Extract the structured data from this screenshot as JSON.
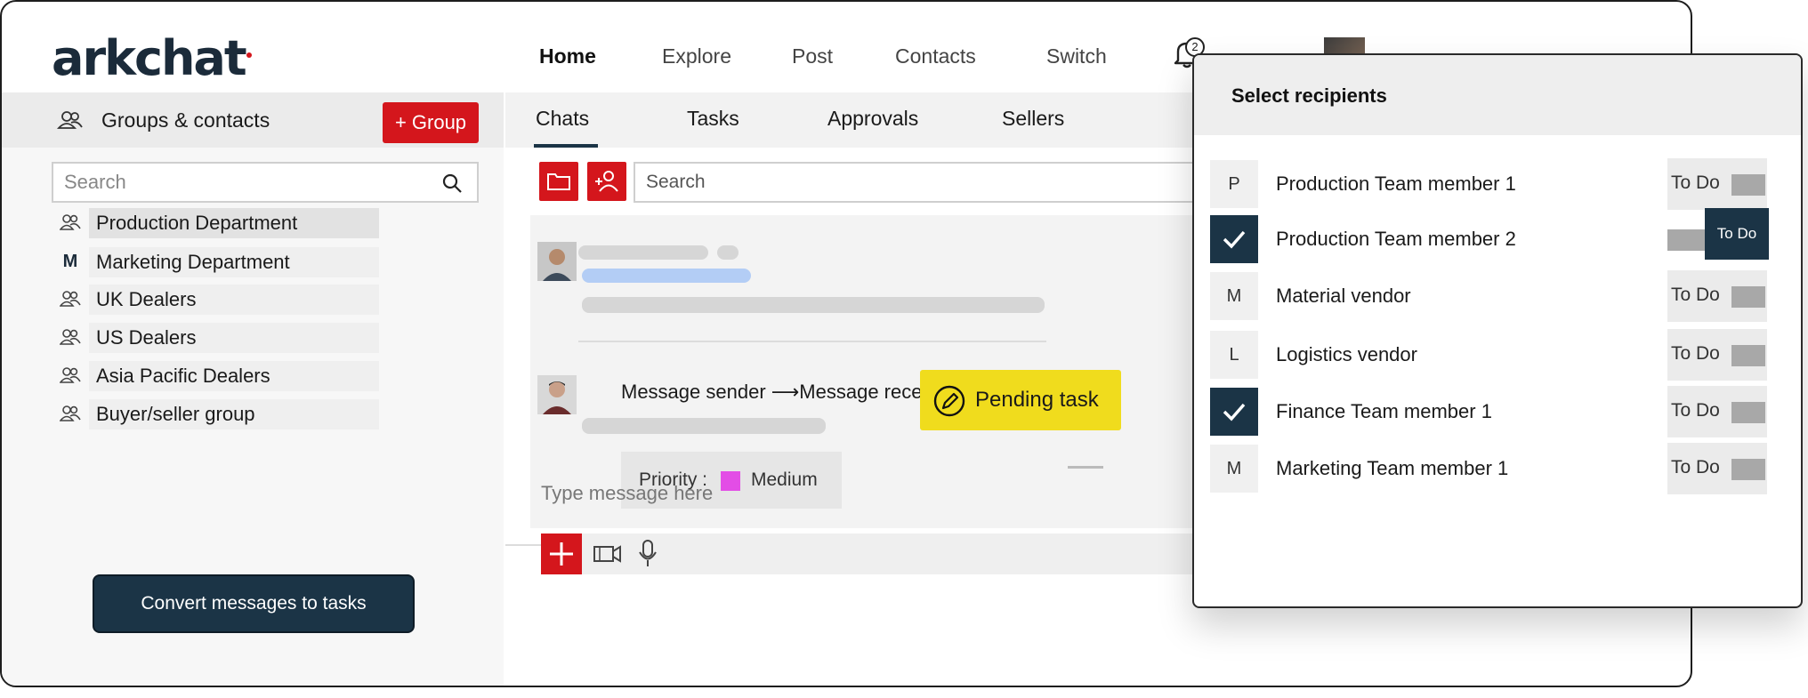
{
  "brand": {
    "name": "arkchat"
  },
  "topnav": [
    "Home",
    "Explore",
    "Post",
    "Contacts",
    "Switch"
  ],
  "notifications": {
    "count": "2"
  },
  "sidebar": {
    "header": "Groups & contacts",
    "add_group_label": "+ Group",
    "search_placeholder": "Search",
    "groups": [
      {
        "icon": "group-icon",
        "initial": "",
        "label": "Production Department",
        "selected": true
      },
      {
        "icon": "letter",
        "initial": "M",
        "label": "Marketing Department",
        "selected": false
      },
      {
        "icon": "group-icon",
        "initial": "",
        "label": "UK Dealers",
        "selected": false
      },
      {
        "icon": "group-icon",
        "initial": "",
        "label": "US Dealers",
        "selected": false
      },
      {
        "icon": "group-icon",
        "initial": "",
        "label": "Asia Pacific Dealers",
        "selected": false
      },
      {
        "icon": "group-icon",
        "initial": "",
        "label": "Buyer/seller group",
        "selected": false
      }
    ],
    "convert_button": "Convert messages to tasks"
  },
  "center": {
    "tabs": [
      "Chats",
      "Tasks",
      "Approvals",
      "Sellers"
    ],
    "active_tab": "Chats",
    "search_placeholder": "Search",
    "message": {
      "sender_receiver": "Message sender ⟶Message receiver",
      "task_status": "Pending task",
      "priority_label": "Priority :",
      "priority_value": "Medium"
    },
    "composer_placeholder": "Type message here"
  },
  "dialog": {
    "title": "Select recipients",
    "recipients": [
      {
        "initial": "P",
        "name": "Production Team member 1",
        "checked": false,
        "todo_label": "To Do",
        "todo_on": false
      },
      {
        "initial": "",
        "name": "Production Team member 2",
        "checked": true,
        "todo_label": "To Do",
        "todo_on": true
      },
      {
        "initial": "M",
        "name": "Material vendor",
        "checked": false,
        "todo_label": "To Do",
        "todo_on": false
      },
      {
        "initial": "L",
        "name": "Logistics vendor",
        "checked": false,
        "todo_label": "To Do",
        "todo_on": false
      },
      {
        "initial": "",
        "name": "Finance Team member 1",
        "checked": true,
        "todo_label": "To Do",
        "todo_on": false
      },
      {
        "initial": "M",
        "name": "Marketing Team member 1",
        "checked": false,
        "todo_label": "To Do",
        "todo_on": false
      }
    ]
  },
  "colors": {
    "brand_red": "#d4161c",
    "navy": "#1b3446",
    "task_yellow": "#f0dc1d",
    "priority_medium": "#e34de6"
  }
}
